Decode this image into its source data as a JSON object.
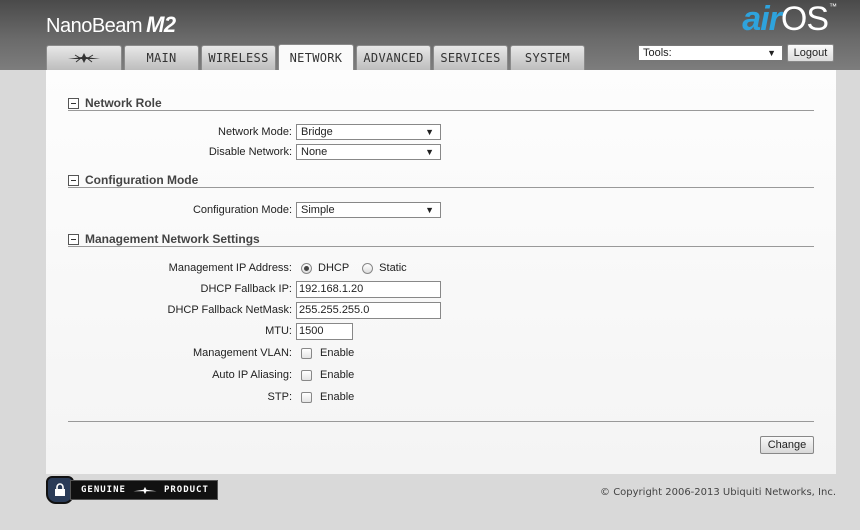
{
  "header": {
    "brand_name": "NanoBeam",
    "brand_model": "M2",
    "logo_air": "air",
    "logo_os": "OS",
    "logo_tm": "™"
  },
  "tabs": [
    {
      "label": "",
      "icon": "ubiquiti-logo-icon"
    },
    {
      "label": "MAIN"
    },
    {
      "label": "WIRELESS"
    },
    {
      "label": "NETWORK",
      "active": true
    },
    {
      "label": "ADVANCED"
    },
    {
      "label": "SERVICES"
    },
    {
      "label": "SYSTEM"
    }
  ],
  "toolbar": {
    "tools_value": "Tools:",
    "logout_label": "Logout"
  },
  "network_role": {
    "title": "Network Role",
    "network_mode_label": "Network Mode:",
    "network_mode_value": "Bridge",
    "disable_network_label": "Disable Network:",
    "disable_network_value": "None"
  },
  "configuration_mode": {
    "title": "Configuration Mode",
    "mode_label": "Configuration Mode:",
    "mode_value": "Simple"
  },
  "management": {
    "title": "Management Network Settings",
    "ip_address_label": "Management IP Address:",
    "dhcp_label": "DHCP",
    "static_label": "Static",
    "dhcp_fallback_ip_label": "DHCP Fallback IP:",
    "dhcp_fallback_ip_value": "192.168.1.20",
    "dhcp_fallback_mask_label": "DHCP Fallback NetMask:",
    "dhcp_fallback_mask_value": "255.255.255.0",
    "mtu_label": "MTU:",
    "mtu_value": "1500",
    "vlan_label": "Management VLAN:",
    "auto_ip_label": "Auto IP Aliasing:",
    "stp_label": "STP:",
    "enable_label": "Enable"
  },
  "actions": {
    "change_label": "Change"
  },
  "footer": {
    "badge_left": "GENUINE",
    "badge_right": "PRODUCT",
    "copyright": "© Copyright 2006-2013 Ubiquiti Networks, Inc."
  }
}
